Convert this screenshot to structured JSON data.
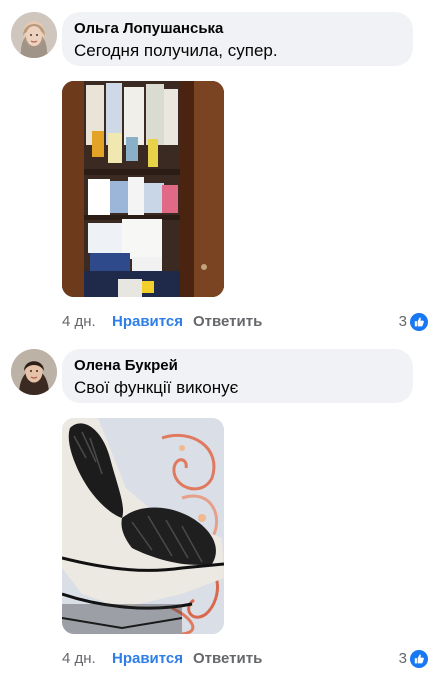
{
  "comments": [
    {
      "author": "Ольга Лопушанська",
      "text": "Сегодня получила, супер.",
      "time": "4 дн.",
      "like_label": "Нравится",
      "reply_label": "Ответить",
      "reaction_count": "3",
      "reaction_icon": "thumbs-up-icon",
      "accent": "#1877f2"
    },
    {
      "author": "Олена Букрей",
      "text": "Свої функції виконує",
      "time": "4 дн.",
      "like_label": "Нравится",
      "reply_label": "Ответить",
      "reaction_count": "3",
      "reaction_icon": "thumbs-up-icon",
      "accent": "#1877f2"
    }
  ]
}
